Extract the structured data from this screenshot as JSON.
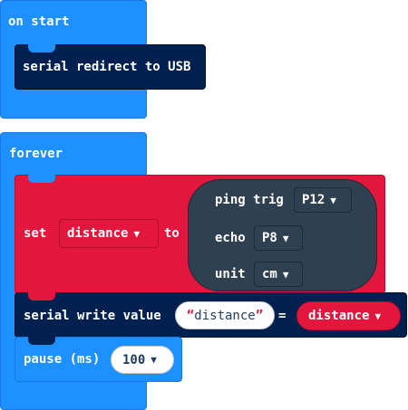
{
  "on_start": {
    "title": "on start",
    "serial_redirect": "serial redirect to USB"
  },
  "forever": {
    "title": "forever",
    "set_block": {
      "set": "set",
      "variable": "distance",
      "to": "to",
      "ping": {
        "trig_label": "ping trig",
        "trig_value": "P12",
        "echo_label": "echo",
        "echo_value": "P8",
        "unit_label": "unit",
        "unit_value": "cm"
      }
    },
    "serial_write": {
      "label": "serial write value",
      "quote_open": "“",
      "name": "distance",
      "quote_close": "”",
      "equals": "=",
      "value": "distance"
    },
    "pause": {
      "label": "pause (ms)",
      "value": "100"
    }
  },
  "caret": "▼",
  "colors": {
    "events": "#1e90ff",
    "serial": "#002050",
    "sonar": "#e3173e",
    "sonar_reporter": "#2f4050",
    "basic": "#1e90ff"
  }
}
